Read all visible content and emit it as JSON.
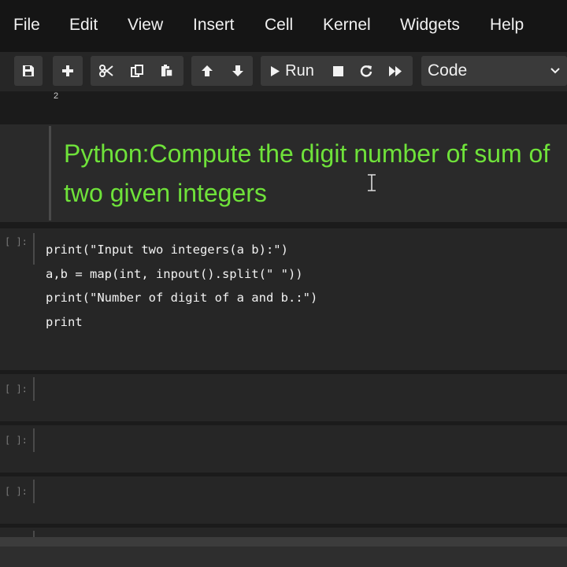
{
  "menu": {
    "items": [
      "File",
      "Edit",
      "View",
      "Insert",
      "Cell",
      "Kernel",
      "Widgets",
      "Help"
    ]
  },
  "toolbar": {
    "run_label": "Run",
    "cell_type": "Code",
    "icons": [
      "save-icon",
      "add-icon",
      "cut-icon",
      "copy-icon",
      "paste-icon",
      "arrow-up-icon",
      "arrow-down-icon",
      "play-icon",
      "stop-icon",
      "restart-icon",
      "fast-forward-icon"
    ],
    "counter": "2"
  },
  "notebook": {
    "markdown_title": "Python:Compute the digit number of sum of two given integers",
    "code_cells": [
      {
        "prompt": "[ ]:",
        "lines": [
          "print(\"Input two integers(a b):\")",
          "a,b = map(int, inpout().split(\" \"))",
          "print(\"Number of digit of a and b.:\")",
          "print"
        ]
      },
      {
        "prompt": "[ ]:",
        "lines": []
      },
      {
        "prompt": "[ ]:",
        "lines": []
      },
      {
        "prompt": "[ ]:",
        "lines": []
      }
    ]
  },
  "colors": {
    "markdown_text": "#6fe23a",
    "background": "#1b1b1b",
    "cell_background": "#262626"
  }
}
